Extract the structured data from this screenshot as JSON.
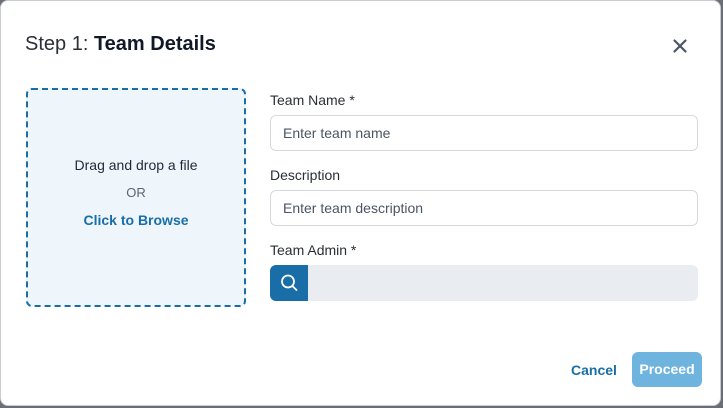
{
  "dialog": {
    "step_label": "Step 1:",
    "title": "Team Details",
    "close_icon": "close-icon"
  },
  "upload": {
    "drag_text": "Drag and drop a file",
    "or_text": "OR",
    "browse_text": "Click to Browse"
  },
  "form": {
    "team_name": {
      "label": "Team Name *",
      "placeholder": "Enter team name",
      "value": ""
    },
    "description": {
      "label": "Description",
      "placeholder": "Enter team description",
      "value": ""
    },
    "team_admin": {
      "label": "Team Admin *",
      "value": "",
      "icon": "search-icon"
    }
  },
  "actions": {
    "cancel_label": "Cancel",
    "proceed_label": "Proceed"
  },
  "colors": {
    "accent": "#1a6ea8",
    "proceed_disabled": "#6fb3df",
    "dropzone_bg": "#eef5fb",
    "admin_field_bg": "#e9edf1"
  }
}
